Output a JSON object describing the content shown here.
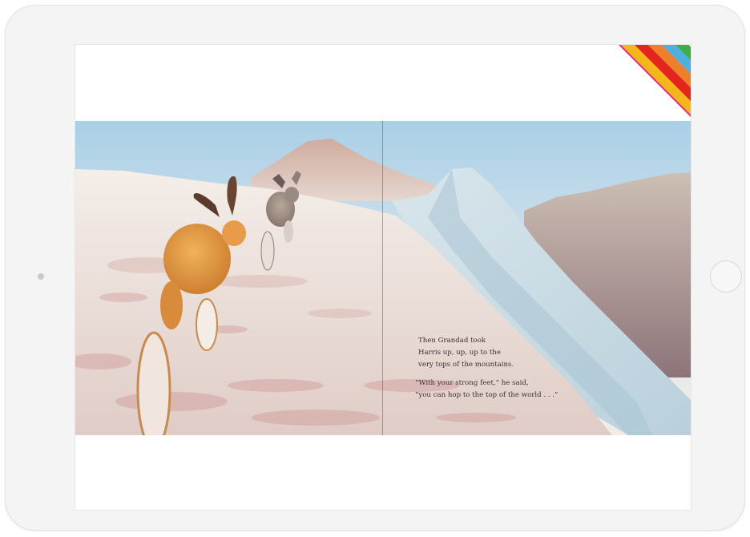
{
  "app": {
    "device": "tablet",
    "colors": {
      "bezel": "#f4f4f4",
      "sky_top": "#a9cfe6",
      "snow": "#ece2dc",
      "ice": "#c9dce6",
      "distant_peak": "#cfa79b",
      "ribbon": [
        "#3fae49",
        "#4fb0e0",
        "#f07f2a",
        "#e2261d",
        "#f5b61c",
        "#e5287b"
      ]
    }
  },
  "book": {
    "corner_ribbon_icon": "rainbow-ribbon-icon",
    "page_text": {
      "paragraph_1": {
        "line_1": "Then Grandad took",
        "line_2": "Harris up, up, up to the",
        "line_3": "very tops of the mountains."
      },
      "paragraph_2": {
        "line_1": "“With your strong feet,” he said,",
        "line_2": "“you can hop to the top of the world . . .”"
      }
    }
  }
}
